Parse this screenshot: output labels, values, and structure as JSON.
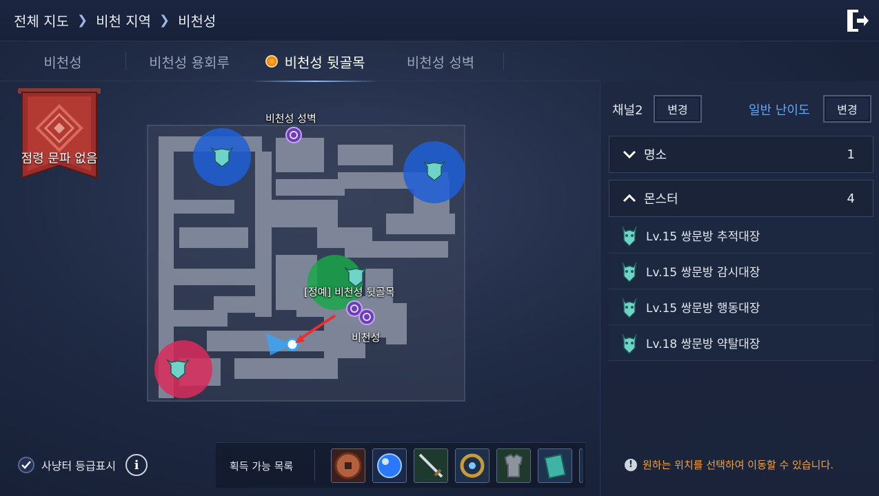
{
  "breadcrumb": {
    "items": [
      "전체 지도",
      "비천 지역",
      "비천성"
    ]
  },
  "tabs": [
    {
      "label": "비천성",
      "active": false
    },
    {
      "label": "비천성 용회루",
      "active": false
    },
    {
      "label": "비천성 뒷골목",
      "active": true
    },
    {
      "label": "비천성 성벽",
      "active": false
    }
  ],
  "banner": {
    "label": "점령 문파 없음"
  },
  "map": {
    "labels": {
      "top_portal": "비천성 성벽",
      "elite": "[정예] 비천성 뒷골목",
      "bottom_portal": "비천성"
    },
    "zone_colors": {
      "blue": "#1f5fd6",
      "green": "#1aa64a",
      "red": "#d92b5c"
    }
  },
  "panel": {
    "channel": "채널2",
    "channel_button": "변경",
    "difficulty": "일반 난이도",
    "difficulty_button": "변경",
    "sections": [
      {
        "label": "명소",
        "count": "1",
        "expanded": false
      },
      {
        "label": "몬스터",
        "count": "4",
        "expanded": true
      }
    ],
    "monsters": [
      "Lv.15 쌍문방 추적대장",
      "Lv.15 쌍문방 감시대장",
      "Lv.15 쌍문방 행동대장",
      "Lv.18 쌍문방 약탈대장"
    ],
    "notice": "원하는 위치를 선택하여 이동할 수 있습니다."
  },
  "bottom": {
    "hunt_toggle_label": "사냥터 등급표시",
    "hunt_toggle_checked": true,
    "obtain_label": "획득 가능 목록",
    "items": [
      "coin-item",
      "blue-orb-item",
      "sword-item",
      "dragon-ring-item",
      "armor-item",
      "book-item"
    ]
  }
}
